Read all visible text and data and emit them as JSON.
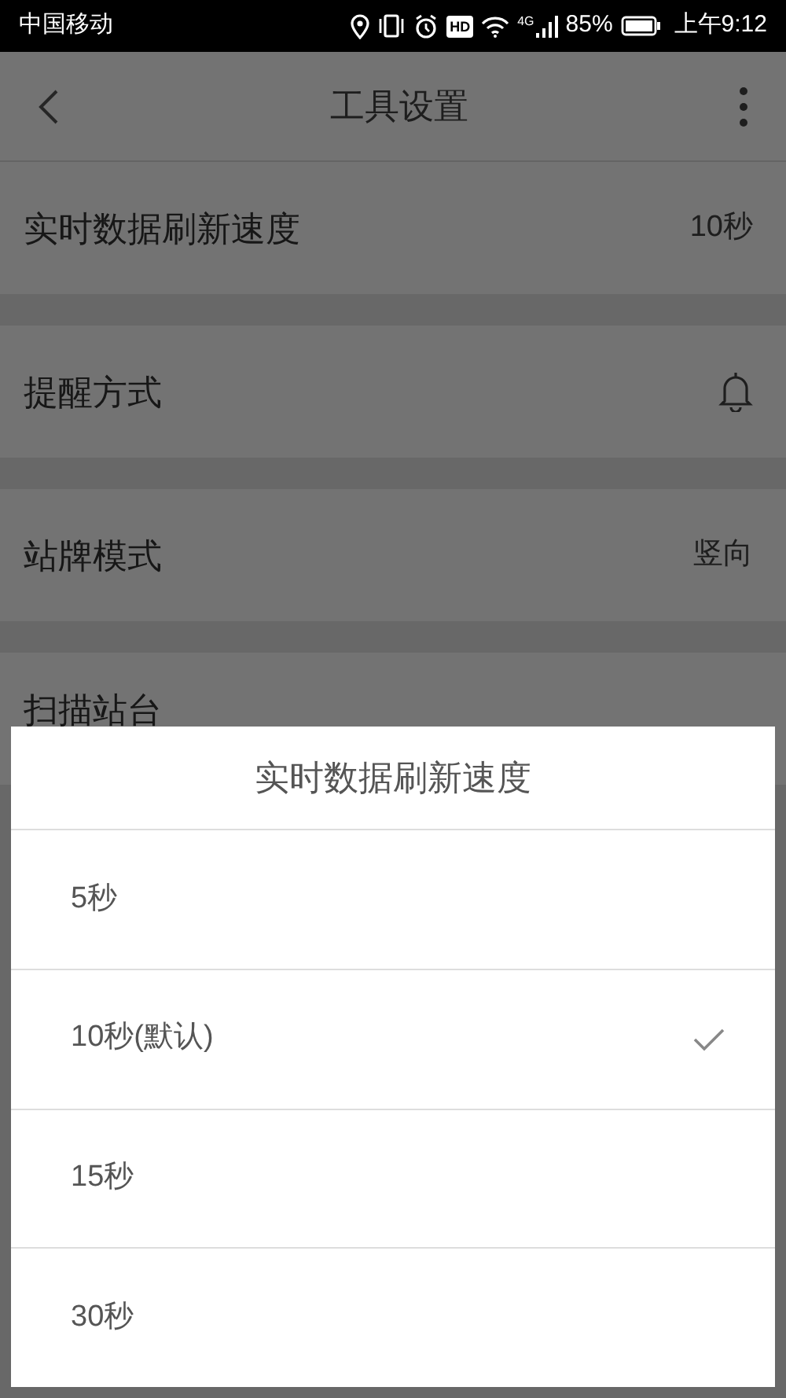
{
  "status_bar": {
    "carrier": "中国移动",
    "hd": "HD",
    "network": "4G",
    "battery": "85%",
    "time": "上午9:12"
  },
  "header": {
    "title": "工具设置"
  },
  "settings": [
    {
      "kind": "value",
      "label": "实时数据刷新速度",
      "value": "10秒"
    },
    {
      "kind": "bell",
      "label": "提醒方式"
    },
    {
      "kind": "value",
      "label": "站牌模式",
      "value": "竖向"
    },
    {
      "kind": "plain",
      "label": "扫描站台"
    }
  ],
  "dialog": {
    "title": "实时数据刷新速度",
    "options": [
      {
        "label": "5秒",
        "selected": false
      },
      {
        "label": "10秒(默认)",
        "selected": true
      },
      {
        "label": "15秒",
        "selected": false
      },
      {
        "label": "30秒",
        "selected": false
      }
    ]
  }
}
